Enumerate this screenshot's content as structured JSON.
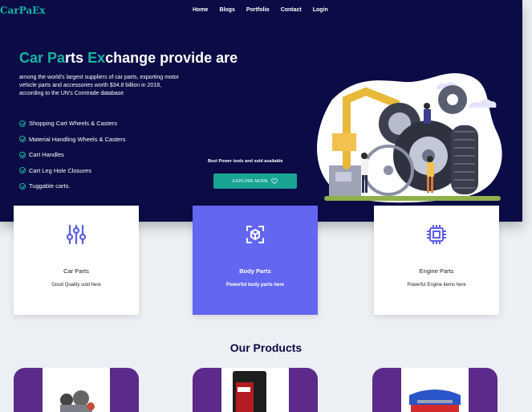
{
  "brand": {
    "logo": "CarPaEx"
  },
  "nav": [
    "Home",
    "Blogs",
    "Portfolio",
    "Contact",
    "Login"
  ],
  "hero": {
    "title_parts": [
      "Car ",
      "Pa",
      "rts ",
      "Ex",
      "change provide are"
    ],
    "description": "among the world's largest suppliers of car parts, exporting motor vehicle parts and accessories worth $34.8 billion in 2018, according to the UN's Comtrade database",
    "features": [
      "Shopping Cart Wheels & Casters",
      "Material Handling Wheels & Casters",
      "Cart Handles",
      "Cart Leg Hole Closures",
      "Tuggable carts."
    ],
    "tagline": "Best Power tools and sold available",
    "cta": "EXPLORE MORE"
  },
  "categories": [
    {
      "title": "Car Parts",
      "subtitle": "Good Quality sold here"
    },
    {
      "title": "Body Parts",
      "subtitle": "Powerful body parts here"
    },
    {
      "title": "Engine Parts",
      "subtitle": "Powerful Engine items here"
    }
  ],
  "products": {
    "heading": "Our Products"
  },
  "colors": {
    "navy": "#0b0b45",
    "teal": "#19b3a0",
    "indigo": "#6366f1",
    "purple": "#5b2a8a"
  }
}
